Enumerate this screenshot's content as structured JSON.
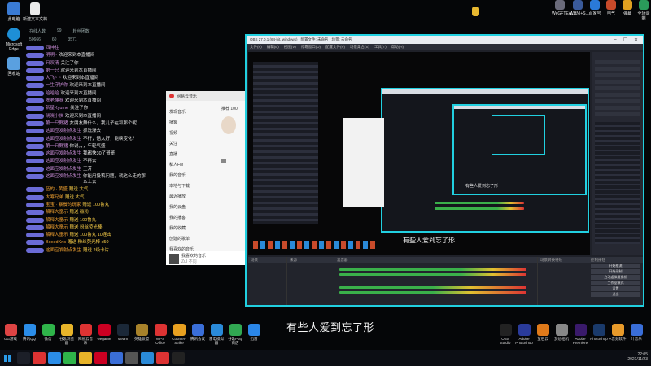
{
  "desktop": {
    "top_icons": [
      {
        "label": "此电脑",
        "color": "#3a7bd5"
      },
      {
        "label": "新建文本文档",
        "color": "#e8e8e8"
      },
      {
        "label": "Microsoft Edge",
        "color": "#1e8fd6"
      },
      {
        "label": "回收站",
        "color": "#5aa0e0"
      }
    ],
    "top_right_icons": [
      "WeGFTEAL...",
      "WHNI+S...",
      "百家号",
      "电气",
      "弹幕",
      "全场录制"
    ]
  },
  "chat": {
    "stats": [
      "在线人数",
      "99",
      "粉丝团数"
    ],
    "stats_values": [
      "50666",
      "60",
      "3571"
    ],
    "messages": [
      {
        "name": "四神柱",
        "text": "",
        "type": "msg"
      },
      {
        "name": "明明~",
        "text": "欢迎来到本直播间",
        "type": "msg"
      },
      {
        "name": "只叹清",
        "text": "关注了你",
        "type": "msg"
      },
      {
        "name": "第一只",
        "text": "欢迎来到本直播间",
        "type": "msg"
      },
      {
        "name": "大飞~ ~",
        "text": "欢迎来到本直播间",
        "type": "msg"
      },
      {
        "name": "一生守护你",
        "text": "欢迎来到本直播间",
        "type": "msg"
      },
      {
        "name": "哈哈哈",
        "text": "欢迎来到本直播间",
        "type": "msg"
      },
      {
        "name": "陈老懂呀",
        "text": "欢迎来到本直播间",
        "type": "msg"
      },
      {
        "name": "新星Kyume",
        "text": "关注了你",
        "type": "msg"
      },
      {
        "name": "晓晓小侠",
        "text": "欢迎来到本直播间",
        "type": "msg"
      },
      {
        "name": "第一只野猪",
        "text": "女朋友舞什么，我儿子在和那个呢",
        "type": "msg"
      },
      {
        "name": "这面应发射点发生",
        "text": "抓洗澡去",
        "type": "msg"
      },
      {
        "name": "这面应发射点发生",
        "text": "不行，话太好，能唤变化？",
        "type": "msg"
      },
      {
        "name": "第一只野猪",
        "text": "你说，，，年轻气盛",
        "type": "msg"
      },
      {
        "name": "这面应发射点发生",
        "text": "我都快30了哥哥",
        "type": "msg"
      },
      {
        "name": "这面应发射点发生",
        "text": "不再去",
        "type": "msg"
      },
      {
        "name": "这面应发射点发生",
        "text": "王芳",
        "type": "msg"
      },
      {
        "name": "这面应发射点发生",
        "text": "你能用投稿问题，就这么走的那么上去",
        "type": "msg"
      },
      {
        "name": "伍的 · 黄盛",
        "text": "赠送 大气",
        "type": "gift"
      },
      {
        "name": "大寒兄弟",
        "text": "赠送 大气",
        "type": "gift"
      },
      {
        "name": "宝宝 · 暴餐的玩家",
        "text": "赠送 100鲁丸",
        "type": "gift"
      },
      {
        "name": "解释大童示",
        "text": "赠送 碳粉",
        "type": "gift"
      },
      {
        "name": "解释大童示",
        "text": "赠送 100鲁丸",
        "type": "gift"
      },
      {
        "name": "解释大童示",
        "text": "赠送 粉丝荧光棒",
        "type": "gift"
      },
      {
        "name": "解释大童示",
        "text": "赠送 100鲁丸 10连击",
        "type": "gift"
      },
      {
        "name": "BoxedKris",
        "text": "赠送 粉丝荧光棒 x50",
        "type": "gift"
      },
      {
        "name": "这面应发射点发生",
        "text": "赠送 2级卡片",
        "type": "gift"
      }
    ]
  },
  "music": {
    "title": "网易云音乐",
    "sidebar": [
      "发现音乐",
      "播客",
      "视频",
      "关注",
      "直播",
      "私人FM",
      "我的音乐",
      "本地与下载",
      "最近播放",
      "我的云盘",
      "我的播客",
      "我的收藏",
      "创建的歌单",
      "我喜欢的音乐"
    ],
    "tabs_top": "推荐 100",
    "track_title": "我喜欢的音乐",
    "track_artist": "ZuI 不同"
  },
  "obs": {
    "title": "OBS 27.0.1 (64-bit, windows) - 配置文件: 未命名 - 场景: 未命名",
    "menus": [
      "文件(F)",
      "编辑(E)",
      "视图(V)",
      "停靠窗口(D)",
      "配置文件(P)",
      "场景集合(S)",
      "工具(T)",
      "帮助(H)"
    ],
    "bottom_docks": [
      "场景",
      "来源",
      "混音器",
      "场景转换特效",
      "控制按钮"
    ],
    "controls": [
      "开始推流",
      "开始录制",
      "启动虚拟摄像机",
      "工作室模式",
      "设置",
      "退出"
    ],
    "inner_caption": "有些人爱到忘了形",
    "nested_caption": "有些人爱到忘了形"
  },
  "caption": "有些人爱到忘了形",
  "apps": [
    {
      "label": "GG游戏",
      "color": "#d44"
    },
    {
      "label": "腾讯QQ",
      "color": "#2b8de8"
    },
    {
      "label": "微信",
      "color": "#2fb44a"
    },
    {
      "label": "谷歌浏览器",
      "color": "#e8b42a"
    },
    {
      "label": "网易云音乐",
      "color": "#d33"
    },
    {
      "label": "wegame",
      "color": "#c02"
    },
    {
      "label": "steam",
      "color": "#1b2838"
    },
    {
      "label": "英雄联盟",
      "color": "#a8822a"
    },
    {
      "label": "WPS Office",
      "color": "#d33"
    },
    {
      "label": "Counter-Strike",
      "color": "#e8a020"
    },
    {
      "label": "腾讯会议",
      "color": "#3a6ed8"
    },
    {
      "label": "雷电模拟器",
      "color": "#2a8ad8"
    },
    {
      "label": "谷歌Play商店",
      "color": "#31a852"
    },
    {
      "label": "迅雷",
      "color": "#2a86e8"
    }
  ],
  "apps_right": [
    {
      "label": "OBS Studio",
      "color": "#222"
    },
    {
      "label": "Adobe Photoshop",
      "color": "#2a3b9b"
    },
    {
      "label": "萤石云",
      "color": "#e07a1a"
    },
    {
      "label": "梦想相机",
      "color": "#888"
    },
    {
      "label": "Adobe Premiere",
      "color": "#3a1a6b"
    },
    {
      "label": "Photoshop",
      "color": "#1a3a6b"
    },
    {
      "label": "A音频软件",
      "color": "#e89a2a"
    },
    {
      "label": "叶音乐",
      "color": "#3a6ed8"
    }
  ],
  "tray": {
    "time": "22:05",
    "date": "2021/11/23"
  }
}
